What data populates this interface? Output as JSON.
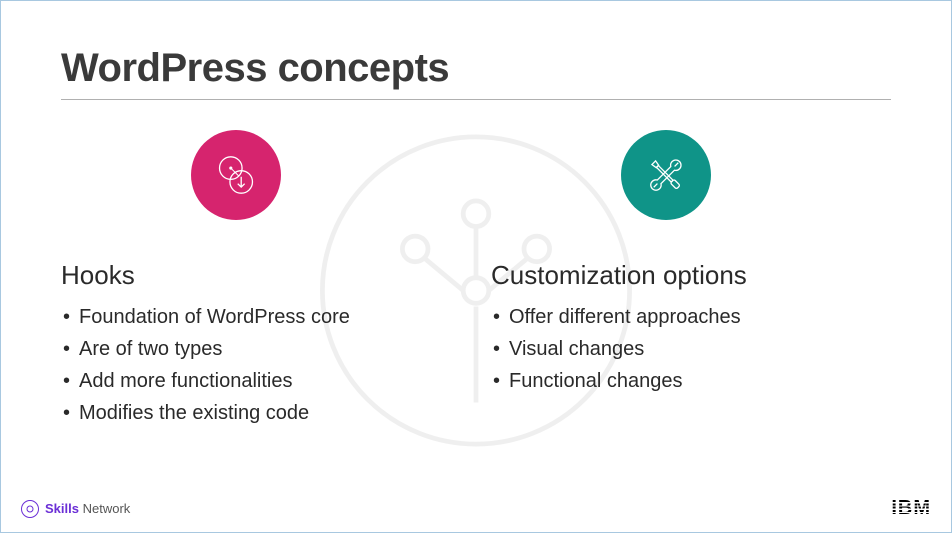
{
  "title": "WordPress concepts",
  "columns": {
    "left": {
      "icon": "hooks-circles-icon",
      "heading": "Hooks",
      "bullets": [
        "Foundation of WordPress core",
        "Are of two types",
        "Add more functionalities",
        "Modifies the existing code"
      ]
    },
    "right": {
      "icon": "tools-wrench-screwdriver-icon",
      "heading": "Customization options",
      "bullets": [
        "Offer different approaches",
        "Visual changes",
        "Functional changes"
      ]
    }
  },
  "footer": {
    "skills_word": "Skills",
    "network_word": "Network",
    "ibm": "IBM"
  }
}
